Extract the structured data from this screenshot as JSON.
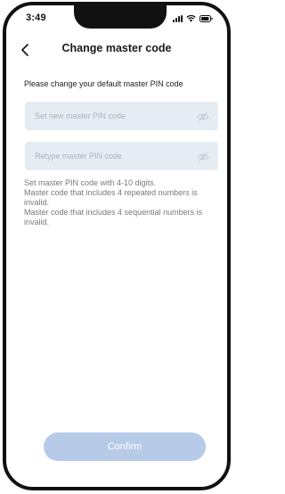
{
  "status_bar": {
    "time": "3:49",
    "icons": [
      "signal-icon",
      "wifi-icon",
      "battery-icon"
    ]
  },
  "header": {
    "back_icon": "chevron-left-icon",
    "title": "Change master code"
  },
  "form": {
    "instruction": "Please change your default master PIN code",
    "new_code": {
      "placeholder": "Set new master PIN code",
      "value": "",
      "icon": "eye-hidden-icon"
    },
    "retype_code": {
      "placeholder": "Retype master PIN code",
      "value": "",
      "icon": "eye-hidden-icon"
    },
    "hints": [
      "Set master PIN code with 4-10 digits.",
      "Master code that includes 4 repeated numbers is invalid.",
      "Master code that includes 4 sequential numbers is invalid."
    ]
  },
  "actions": {
    "confirm_label": "Confirm"
  },
  "colors": {
    "field_bg": "#e6ecf4",
    "placeholder": "#a9b4c3",
    "button_disabled": "#b7cbe9",
    "hint_text": "#7a7a7a"
  }
}
